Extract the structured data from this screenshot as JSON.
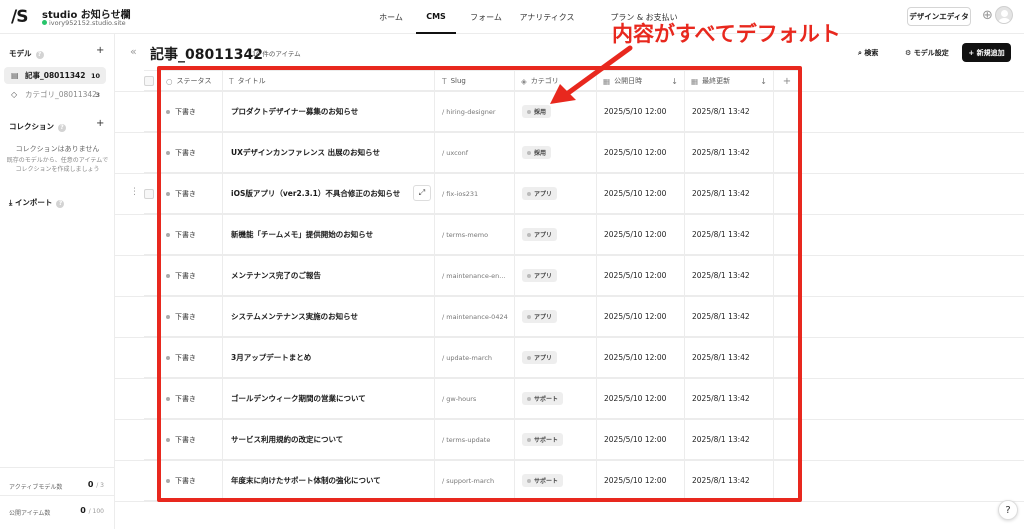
{
  "app": {
    "logo": "/S",
    "site_name": "studio お知らせ欄",
    "site_url": "ivory952152.studio.site",
    "nav": [
      "ホーム",
      "CMS",
      "フォーム",
      "アナリティクス",
      "プラン & お支払い"
    ],
    "active_nav": "CMS",
    "design_editor": "デザインエディタ"
  },
  "sidebar": {
    "model_heading": "モデル",
    "models": [
      {
        "label": "記事_08011342",
        "count": "10"
      },
      {
        "label": "カテゴリ_08011342",
        "count": "3"
      }
    ],
    "collection_heading": "コレクション",
    "collection_empty": "コレクションはありません",
    "collection_desc": "既存のモデルから、任意のアイテムでコレクションを作成しましょう",
    "import_label": "インポート",
    "stats": [
      {
        "label": "アクティブモデル数",
        "value": "0",
        "total": "/ 3"
      },
      {
        "label": "公開アイテム数",
        "value": "0",
        "total": "/ 100"
      }
    ]
  },
  "main": {
    "title": "記事_08011342",
    "item_count": "10 件のアイテム",
    "search": "検索",
    "model_settings": "モデル設定",
    "add_new": "新規追加"
  },
  "table": {
    "columns": [
      "ステータス",
      "タイトル",
      "Slug",
      "カテゴリ",
      "公開日時",
      "最終更新"
    ],
    "rows": [
      {
        "status": "下書き",
        "title": "プロダクトデザイナー募集のお知らせ",
        "slug": "/ hiring-designer",
        "category": "採用",
        "published": "2025/5/10 12:00",
        "updated": "2025/8/1 13:42"
      },
      {
        "status": "下書き",
        "title": "UXデザインカンファレンス 出展のお知らせ",
        "slug": "/ uxconf",
        "category": "採用",
        "published": "2025/5/10 12:00",
        "updated": "2025/8/1 13:42"
      },
      {
        "status": "下書き",
        "title": "iOS版アプリ（ver2.3.1）不具合修正のお知らせ",
        "slug": "/ fix-ios231",
        "category": "アプリ",
        "published": "2025/5/10 12:00",
        "updated": "2025/8/1 13:42"
      },
      {
        "status": "下書き",
        "title": "新機能「チームメモ」提供開始のお知らせ",
        "slug": "/ terms-memo",
        "category": "アプリ",
        "published": "2025/5/10 12:00",
        "updated": "2025/8/1 13:42"
      },
      {
        "status": "下書き",
        "title": "メンテナンス完了のご報告",
        "slug": "/ maintenance-en...",
        "category": "アプリ",
        "published": "2025/5/10 12:00",
        "updated": "2025/8/1 13:42"
      },
      {
        "status": "下書き",
        "title": "システムメンテナンス実施のお知らせ",
        "slug": "/ maintenance-0424",
        "category": "アプリ",
        "published": "2025/5/10 12:00",
        "updated": "2025/8/1 13:42"
      },
      {
        "status": "下書き",
        "title": "3月アップデートまとめ",
        "slug": "/ update-march",
        "category": "アプリ",
        "published": "2025/5/10 12:00",
        "updated": "2025/8/1 13:42"
      },
      {
        "status": "下書き",
        "title": "ゴールデンウィーク期間の営業について",
        "slug": "/ gw-hours",
        "category": "サポート",
        "published": "2025/5/10 12:00",
        "updated": "2025/8/1 13:42"
      },
      {
        "status": "下書き",
        "title": "サービス利用規約の改定について",
        "slug": "/ terms-update",
        "category": "サポート",
        "published": "2025/5/10 12:00",
        "updated": "2025/8/1 13:42"
      },
      {
        "status": "下書き",
        "title": "年度末に向けたサポート体制の強化について",
        "slug": "/ support-march",
        "category": "サポート",
        "published": "2025/5/10 12:00",
        "updated": "2025/8/1 13:42"
      }
    ]
  },
  "annotation": {
    "text": "内容がすべてデフォルト",
    "color": "#e8281e"
  },
  "help": "?"
}
